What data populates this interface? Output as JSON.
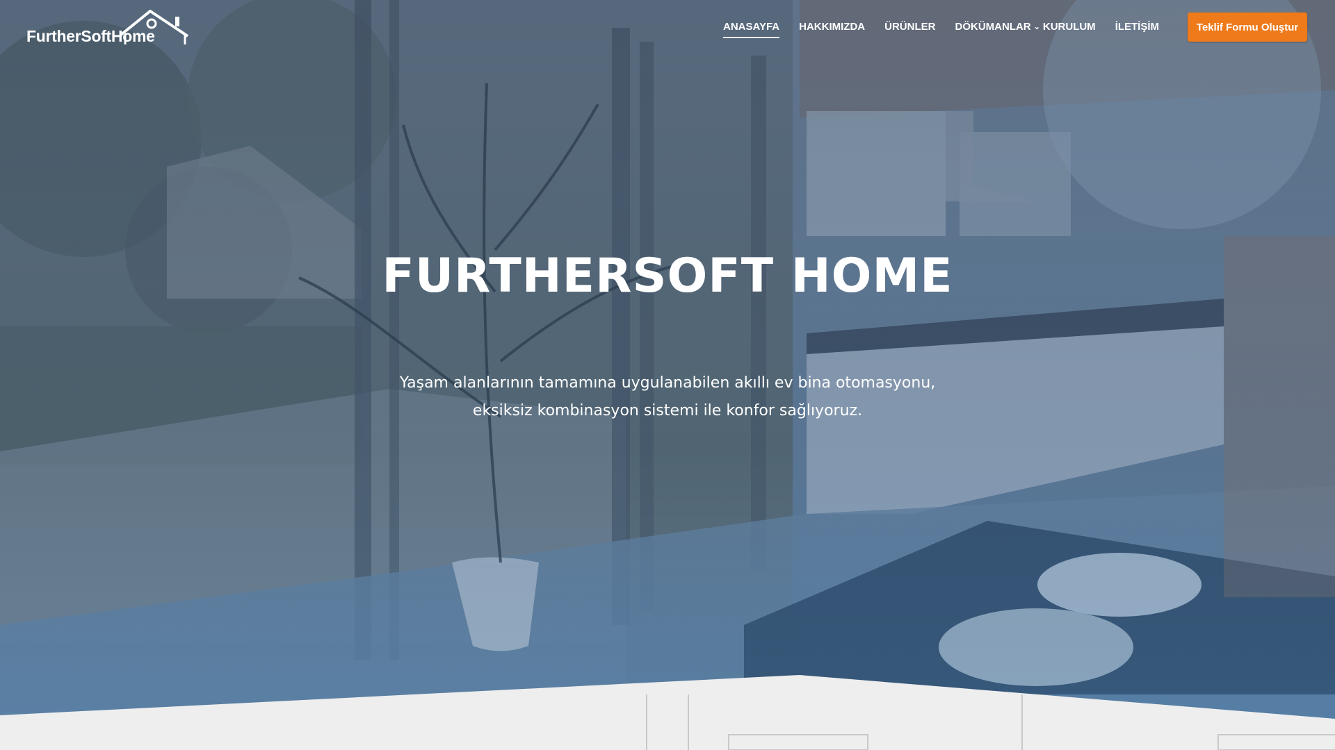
{
  "header": {
    "logo_text": "FurtherSoftHome"
  },
  "nav": {
    "items": [
      {
        "label": "ANASAYFA",
        "active": true
      },
      {
        "label": "HAKKIMIZDA"
      },
      {
        "label": "ÜRÜNLER"
      },
      {
        "label": "DÖKÜMANLAR",
        "has_dropdown": true
      },
      {
        "label": "KURULUM"
      },
      {
        "label": "İLETİŞİM"
      }
    ],
    "cta_label": "Teklif Formu Oluştur"
  },
  "hero": {
    "title": "FURTHERSOFT HOME",
    "subtitle_line1": "Yaşam alanlarının tamamına uygulanabilen akıllı ev bina otomasyonu,",
    "subtitle_line2": "eksiksiz kombinasyon sistemi ile konfor sağlıyoruz."
  },
  "colors": {
    "accent": "#ee7a1a",
    "overlay": "#4a6a8c",
    "footer_band": "#eeeeee"
  },
  "icons": {
    "logo_roof": "house-roof-icon",
    "dropdown": "chevron-down-icon"
  }
}
